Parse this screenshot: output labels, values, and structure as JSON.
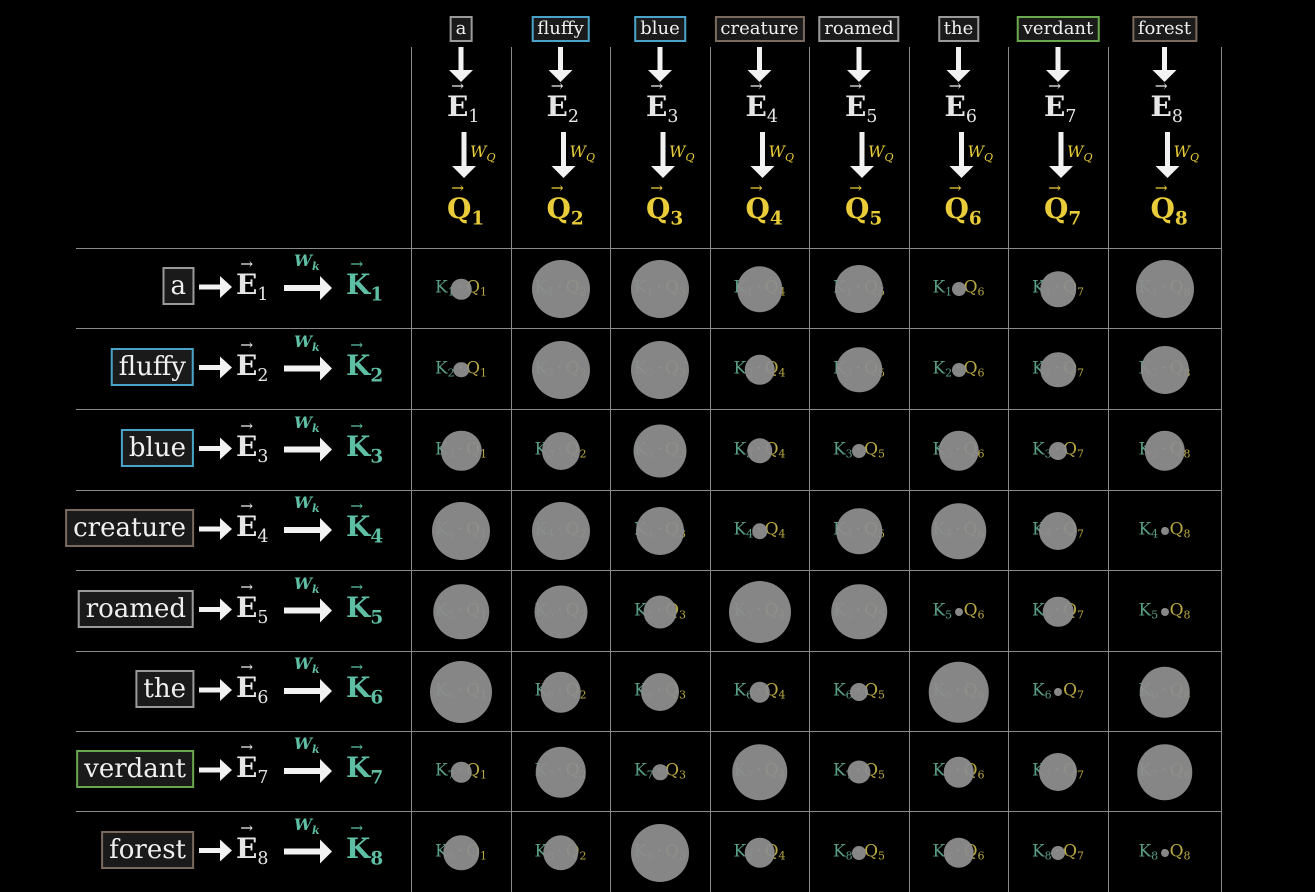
{
  "words": [
    {
      "text": "a",
      "color": "#9a9a9a"
    },
    {
      "text": "fluffy",
      "color": "#4aa3c8"
    },
    {
      "text": "blue",
      "color": "#4aa3c8"
    },
    {
      "text": "creature",
      "color": "#7a6a5e"
    },
    {
      "text": "roamed",
      "color": "#9a9a9a"
    },
    {
      "text": "the",
      "color": "#9a9a9a"
    },
    {
      "text": "verdant",
      "color": "#6aa84f"
    },
    {
      "text": "forest",
      "color": "#7a6a5e"
    }
  ],
  "labels": {
    "embedding_symbol": "E",
    "query_symbol": "Q",
    "key_symbol": "K",
    "query_weight": "W",
    "query_weight_sub": "Q",
    "key_weight": "W",
    "key_weight_sub": "k",
    "dot_operator": "·",
    "indices": [
      "1",
      "2",
      "3",
      "4",
      "5",
      "6",
      "7",
      "8"
    ]
  },
  "colors": {
    "query": "#e8cc3a",
    "key": "#5fbfa5",
    "embedding": "#e6e6e6",
    "dot": "#8d8d8d",
    "grid": "#8a8a8a"
  },
  "attention_weights": [
    [
      0.25,
      1.0,
      1.0,
      0.75,
      0.8,
      0.12,
      0.55,
      1.0
    ],
    [
      0.15,
      1.0,
      1.0,
      0.45,
      0.75,
      0.12,
      0.55,
      0.8
    ],
    [
      0.65,
      0.6,
      0.9,
      0.35,
      0.12,
      0.65,
      0.2,
      0.65
    ],
    [
      1.0,
      1.0,
      0.8,
      0.15,
      0.75,
      0.95,
      0.6,
      0.0
    ],
    [
      0.95,
      0.9,
      0.5,
      1.1,
      0.95,
      0.0,
      0.45,
      0.0
    ],
    [
      1.1,
      0.65,
      0.6,
      0.25,
      0.2,
      1.05,
      0.0,
      0.85
    ],
    [
      0.25,
      0.85,
      0.15,
      0.95,
      0.3,
      0.45,
      0.6,
      0.95
    ],
    [
      0.55,
      0.55,
      1.0,
      0.45,
      0.12,
      0.45,
      0.12,
      0.0
    ]
  ]
}
